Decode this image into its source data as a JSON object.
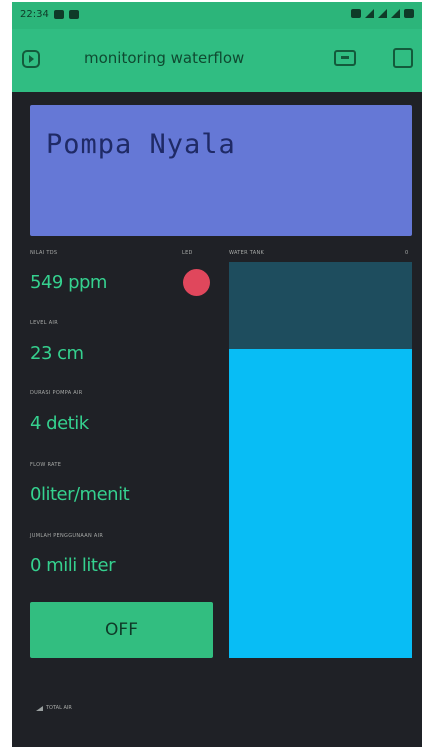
{
  "statusbar": {
    "time": "22:34"
  },
  "appbar": {
    "title": "monitoring waterflow",
    "left_icon": "play-box-icon",
    "device_icon": "device-icon",
    "square_icon": "square-icon"
  },
  "lcd": {
    "text": "Pompa Nyala",
    "color": "#6578d6"
  },
  "widgets": {
    "tds": {
      "label": "NILAI TDS",
      "value": "549 ppm"
    },
    "led": {
      "label": "LED",
      "color": "#e0475c"
    },
    "level": {
      "label": "LEVEL AIR",
      "value": "23 cm"
    },
    "durasi": {
      "label": "DURASI POMPA AIR",
      "value": "4 detik"
    },
    "flow": {
      "label": "FLOW RATE",
      "value": "0liter/menit"
    },
    "jumlah": {
      "label": "JUMLAH PENGGUNAAN AIR",
      "value": "0 mili liter"
    },
    "tank": {
      "label": "WATER TANK",
      "label_right": "0",
      "fill_fraction": 0.78,
      "fill_color": "#08bdf5"
    }
  },
  "button": {
    "label": "OFF"
  },
  "footer": {
    "label": "TOTAL AIR"
  },
  "colors": {
    "accent": "#30bd82",
    "background": "#1f2126",
    "value_text": "#35d18f"
  }
}
